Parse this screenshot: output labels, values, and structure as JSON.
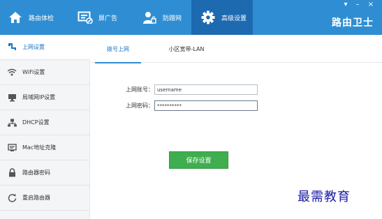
{
  "app": {
    "brand": "路由卫士",
    "window_controls": {
      "menu": "▾",
      "minimize": "–",
      "close": "×"
    }
  },
  "topnav": {
    "tabs": [
      {
        "label": "路由体检",
        "icon": "home-icon",
        "active": false
      },
      {
        "label": "屏广告",
        "icon": "block-ads-icon",
        "active": false
      },
      {
        "label": "防蹭网",
        "icon": "anti-leech-icon",
        "active": false
      },
      {
        "label": "高级设置",
        "icon": "gear-icon",
        "active": true
      }
    ]
  },
  "sidebar": {
    "items": [
      {
        "label": "上网设置",
        "icon": "network-icon",
        "active": true
      },
      {
        "label": "WiFi设置",
        "icon": "wifi-icon",
        "active": false
      },
      {
        "label": "局域网IP设置",
        "icon": "lan-ip-icon",
        "active": false
      },
      {
        "label": "DHCP设置",
        "icon": "dhcp-icon",
        "active": false
      },
      {
        "label": "Mac地址克隆",
        "icon": "mac-clone-icon",
        "active": false
      },
      {
        "label": "路由器密码",
        "icon": "lock-icon",
        "active": false
      },
      {
        "label": "重启路由器",
        "icon": "restart-icon",
        "active": false
      }
    ]
  },
  "subtabs": [
    {
      "label": "拨号上网",
      "active": true
    },
    {
      "label": "小区宽带-LAN",
      "active": false
    }
  ],
  "form": {
    "account_label": "上网账号：",
    "account_value": "username",
    "password_label": "上网密码：",
    "password_value": "**********"
  },
  "save_button": "保存设置",
  "watermark": "最需教育",
  "colors": {
    "accent": "#2f8ed3",
    "active_tab": "#1d6ab0",
    "save": "#3fae4f"
  }
}
